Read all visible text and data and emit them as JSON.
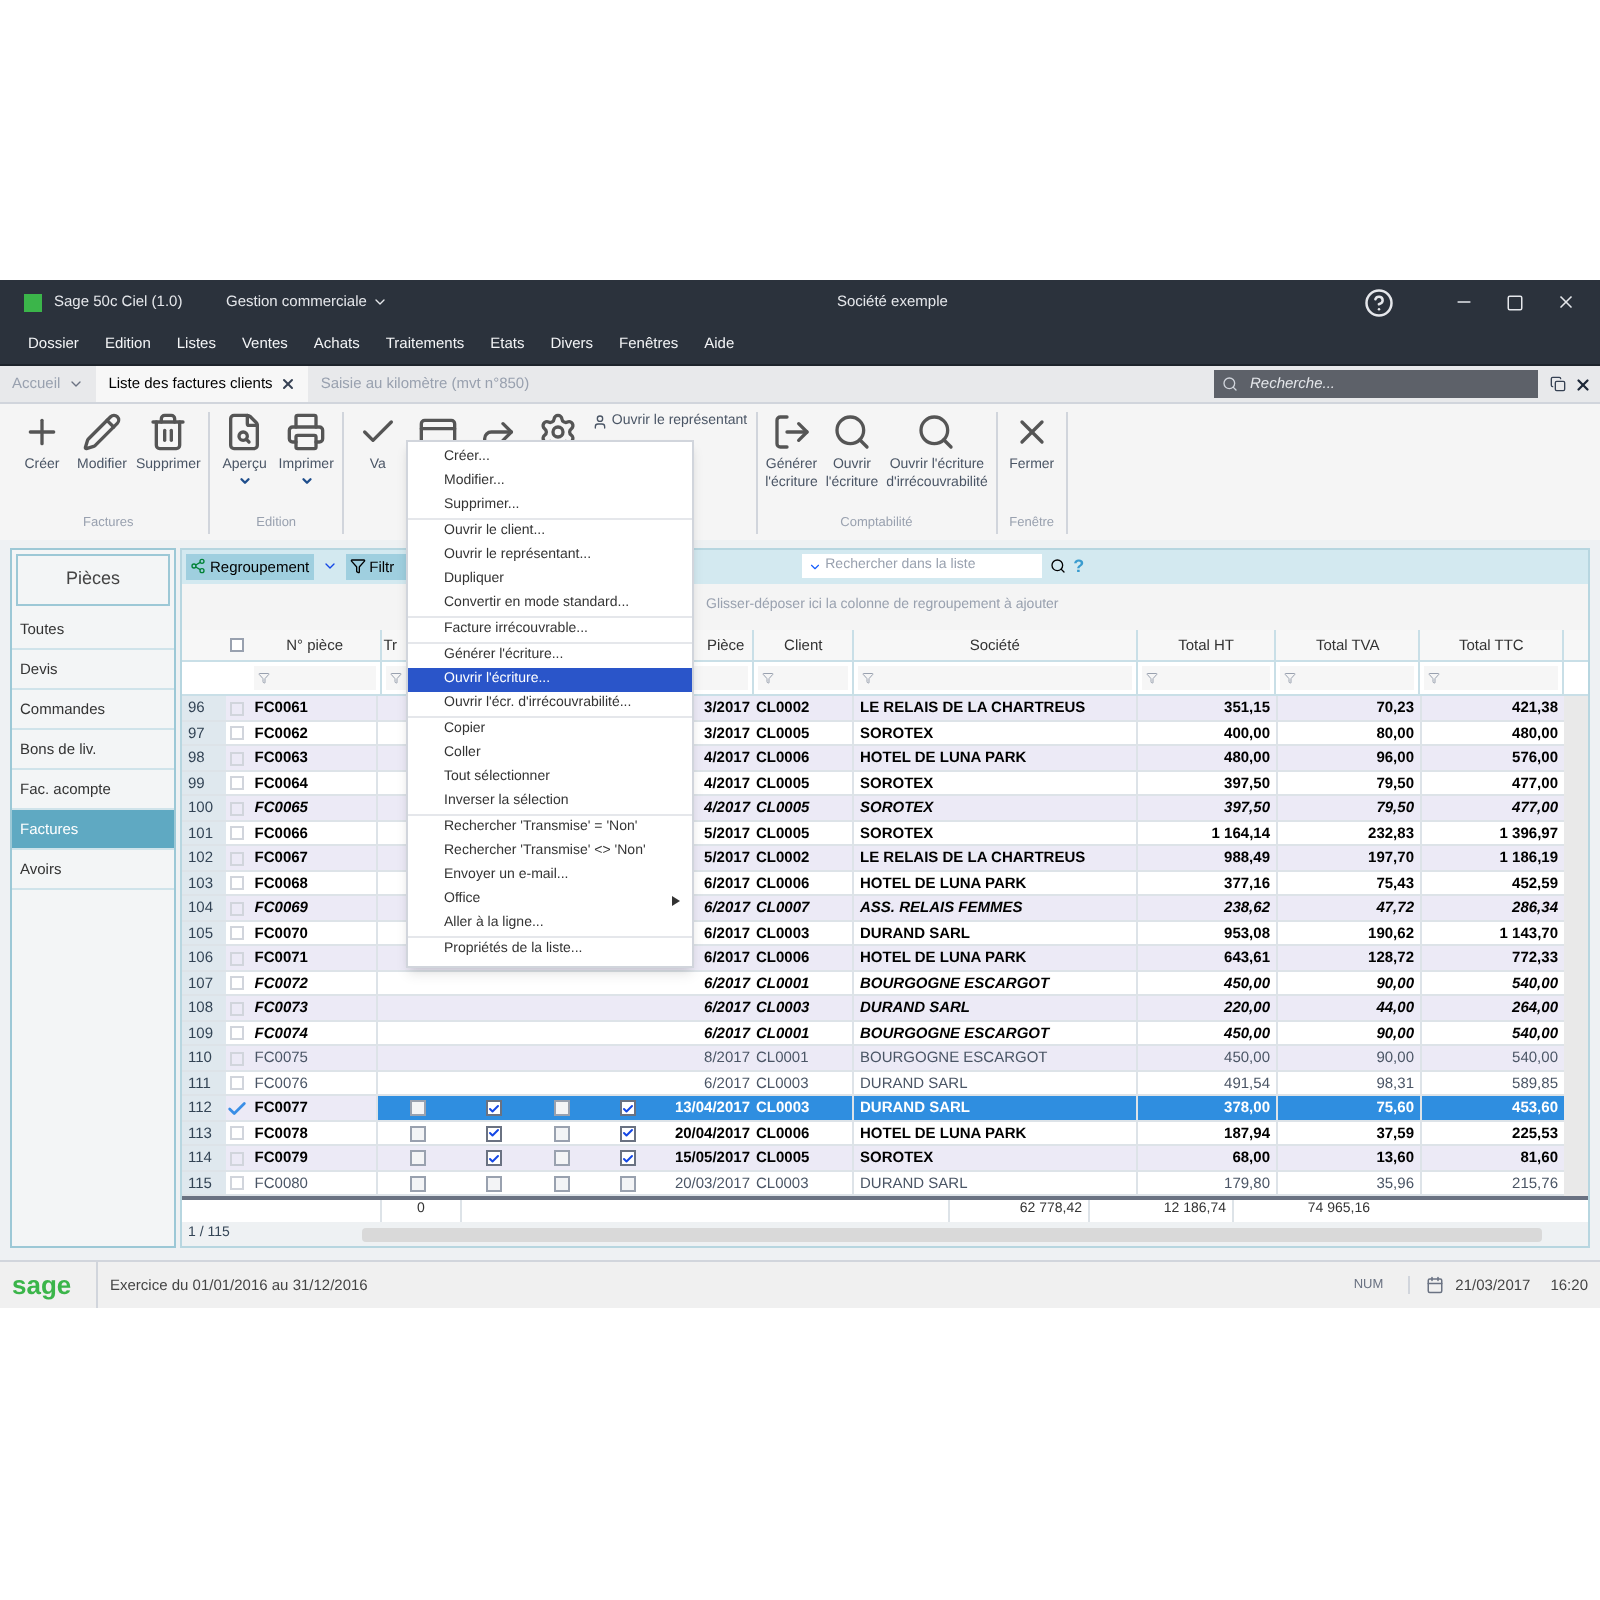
{
  "window": {
    "app_name": "Sage 50c Ciel (1.0)",
    "module": "Gestion commerciale",
    "company": "Société exemple"
  },
  "menu_bar": [
    "Dossier",
    "Edition",
    "Listes",
    "Ventes",
    "Achats",
    "Traitements",
    "Etats",
    "Divers",
    "Fenêtres",
    "Aide"
  ],
  "tabs": [
    {
      "label": "Accueil",
      "selected": false,
      "kind": "dropdown"
    },
    {
      "label": "Liste des factures clients",
      "selected": true,
      "kind": "closable"
    },
    {
      "label": "Saisie au kilomètre (mvt n°850)",
      "selected": false,
      "kind": "plain"
    }
  ],
  "global_search": {
    "placeholder": "Recherche..."
  },
  "ribbon": [
    {
      "label": "Factures",
      "buttons": [
        {
          "label": "Créer",
          "dropdown": false
        },
        {
          "label": "Modifier",
          "dropdown": false
        },
        {
          "label": "Supprimer",
          "dropdown": false
        }
      ]
    },
    {
      "label": "Edition",
      "buttons": [
        {
          "label": "Aperçu",
          "dropdown": true
        },
        {
          "label": "Imprimer",
          "dropdown": true
        }
      ]
    },
    {
      "buttons": [
        {
          "label": "Va",
          "dropdown": false
        },
        {
          "dropdown": false
        },
        {
          "dropdown": false
        },
        {
          "dropdown": false
        }
      ],
      "small_button": "Ouvrir le représentant"
    },
    {
      "label": "Comptabilité",
      "buttons": [
        {
          "label": "Générer\nl'écriture",
          "dropdown": false
        },
        {
          "label": "Ouvrir\nl'écriture",
          "dropdown": false
        },
        {
          "label": "Ouvrir l'écriture\nd'irrécouvrabilité",
          "dropdown": false
        }
      ]
    },
    {
      "label": "Fenêtre",
      "buttons": [
        {
          "label": "Fermer",
          "dropdown": false
        }
      ]
    }
  ],
  "sidebar": {
    "title": "Pièces",
    "items": [
      {
        "label": "Toutes",
        "selected": false
      },
      {
        "label": "Devis",
        "selected": false
      },
      {
        "label": "Commandes",
        "selected": false
      },
      {
        "label": "Bons de liv.",
        "selected": false
      },
      {
        "label": "Fac. acompte",
        "selected": false
      },
      {
        "label": "Factures",
        "selected": true
      },
      {
        "label": "Avoirs",
        "selected": false
      }
    ]
  },
  "grid_toolbar": {
    "group_button": "Regroupement",
    "filter_button": "Filtr",
    "search_placeholder": "Rechercher dans la liste",
    "help": "?"
  },
  "group_hint": "Glisser-déposer ici la colonne de regroupement à ajouter",
  "header_checkbox": {
    "checked": false
  },
  "columns": {
    "piece": "N° pièce",
    "column_4": "Tr",
    "column_8": "Pièce",
    "client": "Client",
    "societe": "Société",
    "total_ht": "Total HT",
    "total_tva": "Total TVA",
    "total_ttc": "Total TTC"
  },
  "rows": [
    {
      "num": "96",
      "checked": false,
      "selected": false,
      "kind": "bold",
      "piece": "FC0061",
      "date": "3/2017",
      "client": "CL0002",
      "societe": "LE RELAIS DE LA CHARTREUS",
      "ht": "351,15",
      "tva": "70,23",
      "ttc": "421,38"
    },
    {
      "num": "97",
      "checked": false,
      "selected": false,
      "kind": "bold",
      "piece": "FC0062",
      "date": "3/2017",
      "client": "CL0005",
      "societe": "SOROTEX",
      "ht": "400,00",
      "tva": "80,00",
      "ttc": "480,00"
    },
    {
      "num": "98",
      "checked": false,
      "selected": false,
      "kind": "bold",
      "piece": "FC0063",
      "date": "4/2017",
      "client": "CL0006",
      "societe": "HOTEL DE LUNA PARK",
      "ht": "480,00",
      "tva": "96,00",
      "ttc": "576,00"
    },
    {
      "num": "99",
      "checked": false,
      "selected": false,
      "kind": "bold",
      "piece": "FC0064",
      "date": "4/2017",
      "client": "CL0005",
      "societe": "SOROTEX",
      "ht": "397,50",
      "tva": "79,50",
      "ttc": "477,00"
    },
    {
      "num": "100",
      "checked": false,
      "selected": false,
      "kind": "bold_italic",
      "piece": "FC0065",
      "date": "4/2017",
      "client": "CL0005",
      "societe": "SOROTEX",
      "ht": "397,50",
      "tva": "79,50",
      "ttc": "477,00"
    },
    {
      "num": "101",
      "checked": false,
      "selected": false,
      "kind": "bold",
      "piece": "FC0066",
      "date": "5/2017",
      "client": "CL0005",
      "societe": "SOROTEX",
      "ht": "1 164,14",
      "tva": "232,83",
      "ttc": "1 396,97"
    },
    {
      "num": "102",
      "checked": false,
      "selected": false,
      "kind": "bold",
      "piece": "FC0067",
      "date": "5/2017",
      "client": "CL0002",
      "societe": "LE RELAIS DE LA CHARTREUS",
      "ht": "988,49",
      "tva": "197,70",
      "ttc": "1 186,19"
    },
    {
      "num": "103",
      "checked": false,
      "selected": false,
      "kind": "bold",
      "piece": "FC0068",
      "date": "6/2017",
      "client": "CL0006",
      "societe": "HOTEL DE LUNA PARK",
      "ht": "377,16",
      "tva": "75,43",
      "ttc": "452,59"
    },
    {
      "num": "104",
      "checked": false,
      "selected": false,
      "kind": "bold_italic",
      "piece": "FC0069",
      "date": "6/2017",
      "client": "CL0007",
      "societe": "ASS. RELAIS FEMMES",
      "ht": "238,62",
      "tva": "47,72",
      "ttc": "286,34"
    },
    {
      "num": "105",
      "checked": false,
      "selected": false,
      "kind": "bold",
      "piece": "FC0070",
      "date": "6/2017",
      "client": "CL0003",
      "societe": "DURAND SARL",
      "ht": "953,08",
      "tva": "190,62",
      "ttc": "1 143,70"
    },
    {
      "num": "106",
      "checked": false,
      "selected": false,
      "kind": "bold",
      "piece": "FC0071",
      "date": "6/2017",
      "client": "CL0006",
      "societe": "HOTEL DE LUNA PARK",
      "ht": "643,61",
      "tva": "128,72",
      "ttc": "772,33"
    },
    {
      "num": "107",
      "checked": false,
      "selected": false,
      "kind": "bold_italic",
      "piece": "FC0072",
      "date": "6/2017",
      "client": "CL0001",
      "societe": "BOURGOGNE ESCARGOT",
      "ht": "450,00",
      "tva": "90,00",
      "ttc": "540,00"
    },
    {
      "num": "108",
      "checked": false,
      "selected": false,
      "kind": "bold_italic",
      "piece": "FC0073",
      "date": "6/2017",
      "client": "CL0003",
      "societe": "DURAND SARL",
      "ht": "220,00",
      "tva": "44,00",
      "ttc": "264,00"
    },
    {
      "num": "109",
      "checked": false,
      "selected": false,
      "kind": "bold_italic",
      "piece": "FC0074",
      "date": "6/2017",
      "client": "CL0001",
      "societe": "BOURGOGNE ESCARGOT",
      "ht": "450,00",
      "tva": "90,00",
      "ttc": "540,00"
    },
    {
      "num": "110",
      "checked": false,
      "selected": false,
      "kind": "plain",
      "piece": "FC0075",
      "date": "8/2017",
      "client": "CL0001",
      "societe": "BOURGOGNE ESCARGOT",
      "ht": "450,00",
      "tva": "90,00",
      "ttc": "540,00"
    },
    {
      "num": "111",
      "checked": false,
      "selected": false,
      "kind": "plain",
      "piece": "FC0076",
      "date": "6/2017",
      "client": "CL0003",
      "societe": "DURAND SARL",
      "ht": "491,54",
      "tva": "98,31",
      "ttc": "589,85"
    },
    {
      "num": "112",
      "checked": true,
      "selected": true,
      "kind": "bold",
      "piece": "FC0077",
      "flags": [
        false,
        true,
        false,
        true
      ],
      "date": "13/04/2017",
      "client": "CL0003",
      "societe": "DURAND SARL",
      "ht": "378,00",
      "tva": "75,60",
      "ttc": "453,60"
    },
    {
      "num": "113",
      "checked": false,
      "selected": false,
      "kind": "bold",
      "piece": "FC0078",
      "flags": [
        false,
        true,
        false,
        true
      ],
      "date": "20/04/2017",
      "client": "CL0006",
      "societe": "HOTEL DE LUNA PARK",
      "ht": "187,94",
      "tva": "37,59",
      "ttc": "225,53"
    },
    {
      "num": "114",
      "checked": false,
      "selected": false,
      "kind": "bold",
      "piece": "FC0079",
      "flags": [
        false,
        true,
        false,
        true
      ],
      "date": "15/05/2017",
      "client": "CL0005",
      "societe": "SOROTEX",
      "ht": "68,00",
      "tva": "13,60",
      "ttc": "81,60"
    },
    {
      "num": "115",
      "checked": false,
      "selected": false,
      "kind": "plain",
      "piece": "FC0080",
      "flags": [
        false,
        false,
        false,
        false
      ],
      "date": "20/03/2017",
      "client": "CL0003",
      "societe": "DURAND SARL",
      "ht": "179,80",
      "tva": "35,96",
      "ttc": "215,76"
    }
  ],
  "totals": {
    "column_4": "0",
    "total_ht": "62 778,42",
    "total_tva": "12 186,74",
    "total_ttc": "74 965,16"
  },
  "pager": "1 / 115",
  "context_menu": {
    "groups": [
      [
        {
          "label": "Créer...",
          "kind": "item",
          "selected": false
        },
        {
          "label": "Modifier...",
          "kind": "item",
          "selected": false
        },
        {
          "label": "Supprimer...",
          "kind": "item",
          "selected": false
        }
      ],
      [
        {
          "label": "Ouvrir le client...",
          "kind": "item",
          "selected": false
        },
        {
          "label": "Ouvrir le représentant...",
          "kind": "item",
          "selected": false
        },
        {
          "label": "Dupliquer",
          "kind": "item",
          "selected": false
        },
        {
          "label": "Convertir en mode standard...",
          "kind": "item",
          "selected": false
        }
      ],
      [
        {
          "label": "Facture irrécouvrable...",
          "kind": "item",
          "selected": false
        }
      ],
      [
        {
          "label": "Générer l'écriture...",
          "kind": "item",
          "selected": false
        },
        {
          "label": "Ouvrir l'écriture...",
          "kind": "item",
          "selected": true
        },
        {
          "label": "Ouvrir l'écr. d'irrécouvrabilité...",
          "kind": "item",
          "selected": false
        }
      ],
      [
        {
          "label": "Copier",
          "kind": "item",
          "selected": false
        },
        {
          "label": "Coller",
          "kind": "item",
          "selected": false
        },
        {
          "label": "Tout sélectionner",
          "kind": "item",
          "selected": false
        },
        {
          "label": "Inverser la sélection",
          "kind": "item",
          "selected": false
        }
      ],
      [
        {
          "label": "Rechercher 'Transmise' = 'Non'",
          "kind": "item",
          "selected": false
        },
        {
          "label": "Rechercher 'Transmise' <> 'Non'",
          "kind": "item",
          "selected": false
        },
        {
          "label": "Envoyer un e-mail...",
          "kind": "item",
          "selected": false
        },
        {
          "label": "Office",
          "kind": "submenu",
          "selected": false
        },
        {
          "label": "Aller à la ligne...",
          "kind": "item",
          "selected": false
        }
      ],
      [
        {
          "label": "Propriétés de la liste...",
          "kind": "item",
          "selected": false
        }
      ]
    ]
  },
  "status_bar": {
    "logo": "sage",
    "exercice": "Exercice du 01/01/2016 au 31/12/2016",
    "num": "NUM",
    "date": "21/03/2017",
    "time": "16:20"
  }
}
